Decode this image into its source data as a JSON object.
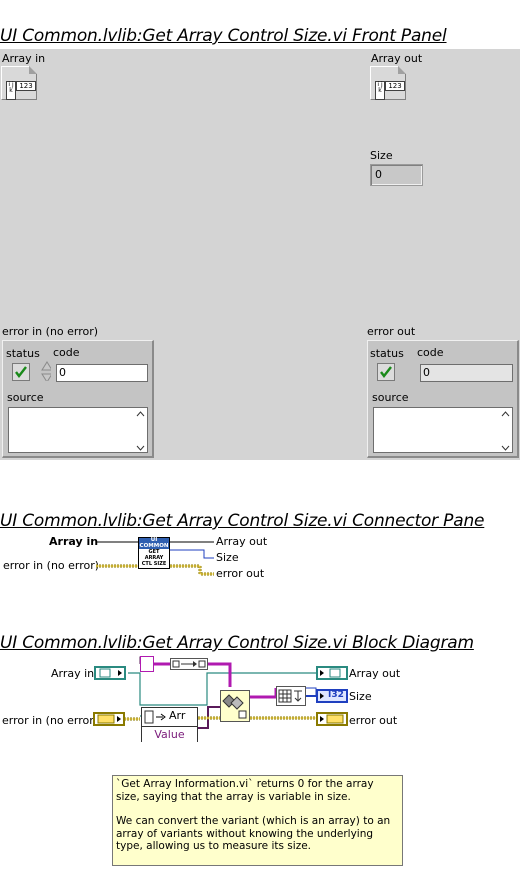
{
  "front_panel": {
    "title": "UI Common.lvlib:Get Array Control Size.vi Front Panel",
    "array_in_label": "Array in",
    "array_out_label": "Array out",
    "array_index_glyph": "i j k",
    "array_element_glyph": "123",
    "size_label": "Size",
    "size_value": "0",
    "error_in": {
      "label": "error in (no error)",
      "status_label": "status",
      "code_label": "code",
      "code_value": "0",
      "source_label": "source"
    },
    "error_out": {
      "label": "error out",
      "status_label": "status",
      "code_label": "code",
      "code_value": "0",
      "source_label": "source"
    }
  },
  "connector_pane": {
    "title": "UI Common.lvlib:Get Array Control Size.vi Connector Pane",
    "inputs": [
      "Array in",
      "error in (no error)"
    ],
    "outputs": [
      "Array out",
      "Size",
      "error out"
    ],
    "icon_top_text": "UI COMMON",
    "icon_bottom_text": "GET ARRAY CTL SIZE"
  },
  "block_diagram": {
    "title": "UI Common.lvlib:Get Array Control Size.vi Block Diagram",
    "array_in_label": "Array in",
    "error_in_label": "error in (no error)",
    "array_out_label": "Array out",
    "size_label": "Size",
    "error_out_label": "error out",
    "property_node_prop": "Arr",
    "property_node_value": "Value",
    "size_type": "I32",
    "comment_line1": "`Get Array Information.vi` returns 0 for the array size, saying that the array is variable in size.",
    "comment_line2": "We can convert the variant (which is an array) to an array of variants without knowing the underlying type, allowing us to measure its size."
  },
  "colors": {
    "panel_bg": "#d4d4d4",
    "error_wire": "#8a7a00",
    "variant_wire": "#5a1a5a",
    "teal_wire": "#2a8a80",
    "blue_wire": "#1f3fbf",
    "comment_bg": "#ffffcc"
  }
}
